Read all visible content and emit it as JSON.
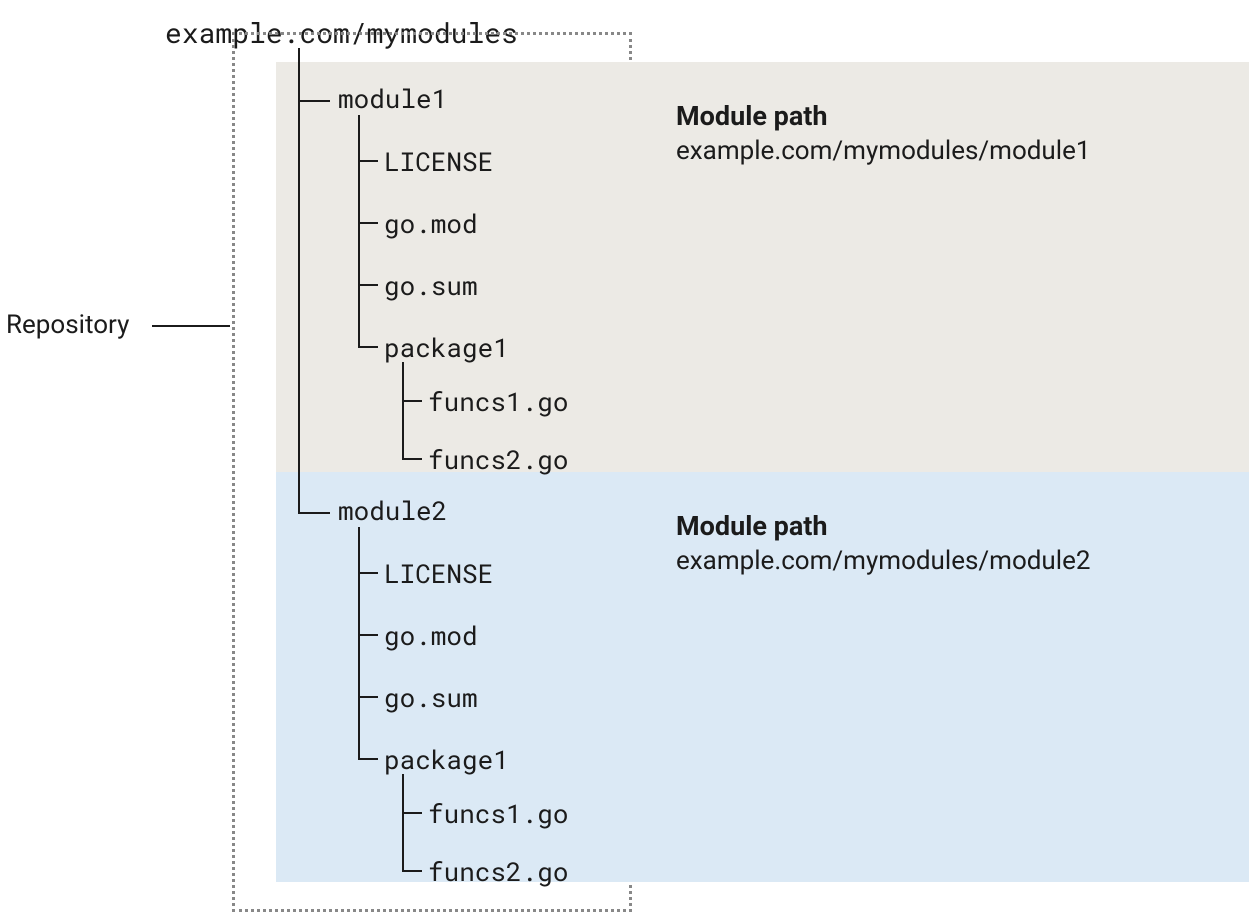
{
  "repo_label": "Repository",
  "repo_root": "example.com/mymodules",
  "module1": {
    "name": "module1",
    "caption_title": "Module path",
    "caption_path": "example.com/mymodules/module1",
    "items": [
      "LICENSE",
      "go.mod",
      "go.sum",
      "package1"
    ],
    "pkg_files": [
      "funcs1.go",
      "funcs2.go"
    ]
  },
  "module2": {
    "name": "module2",
    "caption_title": "Module path",
    "caption_path": "example.com/mymodules/module2",
    "items": [
      "LICENSE",
      "go.mod",
      "go.sum",
      "package1"
    ],
    "pkg_files": [
      "funcs1.go",
      "funcs2.go"
    ]
  }
}
